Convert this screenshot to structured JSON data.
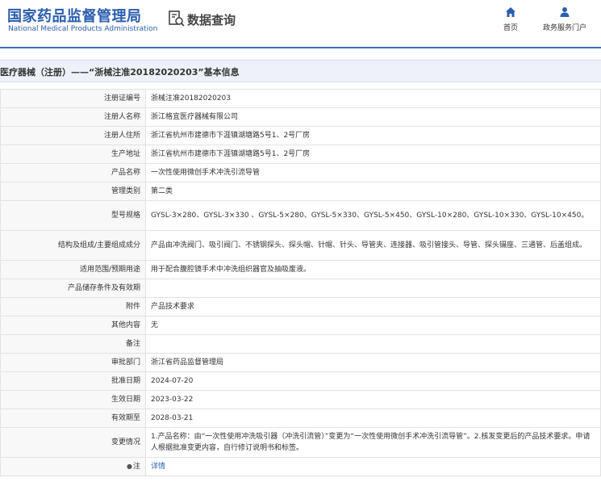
{
  "header": {
    "logo_cn": "国家药品监督管理局",
    "logo_en": "National Medical Products Administration",
    "query_label": "数据查询",
    "nav": [
      {
        "label": "首页",
        "icon": "home-icon"
      },
      {
        "label": "政务服务门户",
        "icon": "user-icon"
      }
    ]
  },
  "colors": {
    "brand": "#2a5db0",
    "accent_line": "#3b6fc2",
    "title_bg": "#eef2f8"
  },
  "title": "医疗器械（注册）——“浙械注准20182020203”基本信息",
  "rows": [
    {
      "label": "注册证编号",
      "value": "浙械注准20182020203"
    },
    {
      "label": "注册人名称",
      "value": "浙江格宜医疗器械有限公司"
    },
    {
      "label": "注册人住所",
      "value": "浙江省杭州市建德市下涯镇湖塘路5号1、2号厂房"
    },
    {
      "label": "生产地址",
      "value": "浙江省杭州市建德市下涯镇湖塘路5号1、2号厂房"
    },
    {
      "label": "产品名称",
      "value": "一次性使用微创手术冲洗引流导管"
    },
    {
      "label": "管理类别",
      "value": "第二类"
    },
    {
      "label": "型号规格",
      "value": "GYSL-3×280、GYSL-3×330 、GYSL-5×280、GYSL-5×330、GYSL-5×450、GYSL-10×280、GYSL-10×330、GYSL-10×450。"
    },
    {
      "label": "结构及组成/主要组成成分",
      "value": "产品由冲洗阀门、吸引阀门、不锈钢探头、探头帽、针帽、针头、导管夹、连接器、吸引管接头、导管、探头镊座、三通管、后盖组成。"
    },
    {
      "label": "适用范围/预期用途",
      "value": "用于配合腹腔镜手术中冲洗组织器官及抽吸废液。"
    },
    {
      "label": "产品储存条件及有效期",
      "value": ""
    },
    {
      "label": "附件",
      "value": "产品技术要求"
    },
    {
      "label": "其他内容",
      "value": "无"
    },
    {
      "label": "备注",
      "value": ""
    },
    {
      "label": "审批部门",
      "value": "浙江省药品监督管理局"
    },
    {
      "label": "批准日期",
      "value": "2024-07-20"
    },
    {
      "label": "生效日期",
      "value": "2023-03-22"
    },
    {
      "label": "有效期至",
      "value": "2028-03-21"
    },
    {
      "label": "变更情况",
      "value": "1.产品名称：由“一次性使用冲洗吸引器（冲洗引流管）”变更为“一次性使用微创手术冲洗引流导管”。2.核发变更后的产品技术要求。申请人根据批准变更内容，自行修订说明书和标签。"
    }
  ],
  "note_row": {
    "label": "注",
    "value": "详情",
    "icon": "info-icon"
  }
}
